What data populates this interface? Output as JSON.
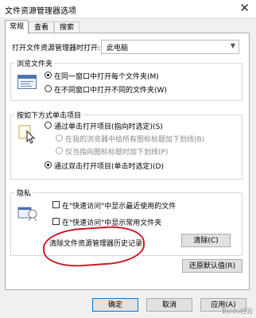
{
  "window": {
    "title": "文件资源管理器选项"
  },
  "tabs": [
    {
      "label": "常规",
      "active": true
    },
    {
      "label": "查看",
      "active": false
    },
    {
      "label": "搜索",
      "active": false
    }
  ],
  "open_explorer": {
    "label": "打开文件资源管理器时打开:",
    "value": "此电脑"
  },
  "browse": {
    "title": "浏览文件夹",
    "options": [
      {
        "label": "在同一窗口中打开每个文件夹(M)",
        "checked": true
      },
      {
        "label": "在不同窗口中打开不同的文件夹(W)",
        "checked": false
      }
    ]
  },
  "click": {
    "title": "按如下方式单击项目",
    "single": "通过单击打开项目(指向时选定)(S)",
    "underline_browser": "在我的浏览器中给所有图标标题加下划线(B)",
    "underline_hover": "仅当指向图标标题时加下划线(P)",
    "double": "通过双击打开项目(单击时选定)(D)"
  },
  "privacy": {
    "title": "隐私",
    "recent_files": "在\"快速访问\"中显示最近使用的文件",
    "frequent_folders": "在\"快速访问\"中显示常用文件夹",
    "clear_label": "清除文件资源管理器历史记录",
    "clear_button": "清除(C)"
  },
  "restore_button": "还原默认值(R)",
  "footer": {
    "ok": "确定",
    "cancel": "取消",
    "apply": "应用(A)"
  },
  "watermark": "Baidu经验",
  "colors": {
    "highlight_circle": "#c81a22",
    "primary_border": "#0078d7"
  }
}
